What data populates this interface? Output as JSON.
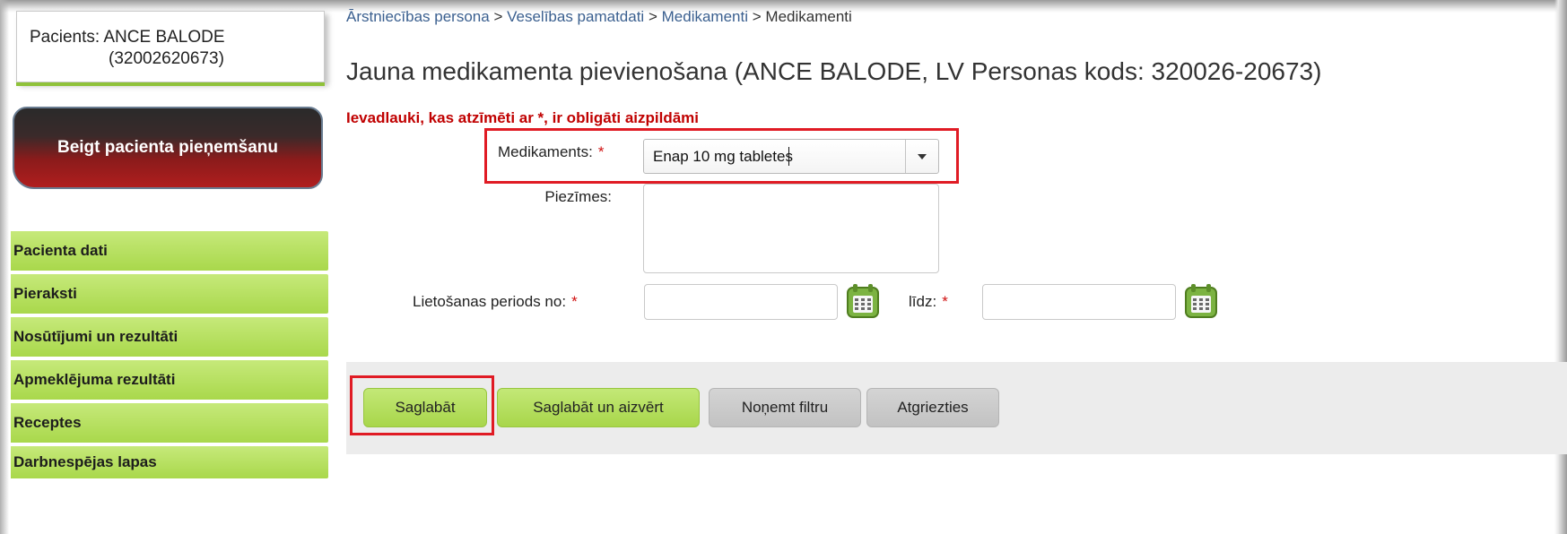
{
  "patient": {
    "line1": "Pacients: ANCE BALODE",
    "line2": "(32002620673)"
  },
  "sidebar": {
    "end_button": "Beigt pacienta pieņemšanu",
    "items": [
      {
        "label": "Pacienta dati"
      },
      {
        "label": "Pieraksti"
      },
      {
        "label": "Nosūtījumi un rezultāti"
      },
      {
        "label": "Apmeklējuma rezultāti"
      },
      {
        "label": "Receptes"
      },
      {
        "label": "Darbnespējas lapas"
      }
    ]
  },
  "breadcrumb": {
    "items": [
      "Ārstniecības persona",
      "Veselības pamatdati",
      "Medikamenti",
      "Medikamenti"
    ],
    "separator": ">"
  },
  "page": {
    "title": "Jauna medikamenta pievienošana (ANCE BALODE, LV Personas kods: 320026-20673)",
    "required_note": "Ievadlauki, kas atzīmēti ar *, ir obligāti aizpildāmi"
  },
  "form": {
    "medication_label": "Medikaments:",
    "medication_value": "Enap 10 mg tabletes",
    "notes_label": "Piezīmes:",
    "notes_value": "",
    "period_from_label": "Lietošanas periods no:",
    "period_from_value": "",
    "period_to_label": "līdz:",
    "period_to_value": "",
    "required_mark": "*"
  },
  "buttons": {
    "save": "Saglabāt",
    "save_close": "Saglabāt un aizvērt",
    "clear_filter": "Noņemt filtru",
    "back": "Atgriezties"
  },
  "icons": {
    "calendar": "calendar-icon",
    "dropdown": "chevron-down-icon"
  },
  "colors": {
    "accent_green": "#a9d84b",
    "highlight_red": "#e01b24",
    "required_red": "#c00000",
    "link_blue": "#3a5f8f"
  }
}
